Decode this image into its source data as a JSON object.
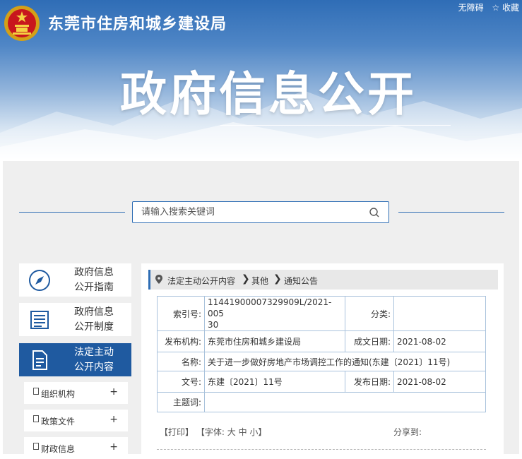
{
  "header": {
    "site_title": "东莞市住房和城乡建设局",
    "banner_title": "政府信息公开",
    "links": [
      "无障碍",
      "☆ 收藏"
    ]
  },
  "search": {
    "placeholder": "请输入搜索关键词",
    "icon": "search-icon"
  },
  "sidebar": {
    "cards": [
      {
        "line1": "政府信息",
        "line2": "公开指南",
        "icon": "compass-icon",
        "active": false
      },
      {
        "line1": "政府信息",
        "line2": "公开制度",
        "icon": "list-icon",
        "active": false
      },
      {
        "line1": "法定主动",
        "line2": "公开内容",
        "icon": "document-icon",
        "active": true
      }
    ],
    "subitems": [
      {
        "label": "组织机构",
        "plus": "+"
      },
      {
        "label": "政策文件",
        "plus": "+"
      },
      {
        "label": "财政信息",
        "plus": "+"
      }
    ]
  },
  "breadcrumb": {
    "items": [
      "法定主动公开内容",
      "其他",
      "通知公告"
    ],
    "separator": "❯"
  },
  "meta": {
    "index_label": "索引号:",
    "index_value_1": "11441900007329909L/2021-005",
    "index_value_2": "30",
    "category_label": "分类:",
    "category_value": "",
    "agency_label": "发布机构:",
    "agency_value": "东莞市住房和城乡建设局",
    "created_label": "成文日期:",
    "created_value": "2021-08-02",
    "name_label": "名称:",
    "name_value": "关于进一步做好房地产市场调控工作的通知(东建〔2021〕11号)",
    "docno_label": "文号:",
    "docno_value": "东建〔2021〕11号",
    "published_label": "发布日期:",
    "published_value": "2021-08-02",
    "subject_label": "主题词:",
    "subject_value": ""
  },
  "tools": {
    "print": "【打印】",
    "font_label": "【字体:",
    "font_large": "大",
    "font_medium": "中",
    "font_small": "小】",
    "share": "分享到:"
  },
  "colors": {
    "accent": "#1f5aa0",
    "border": "#a9c2dc"
  }
}
